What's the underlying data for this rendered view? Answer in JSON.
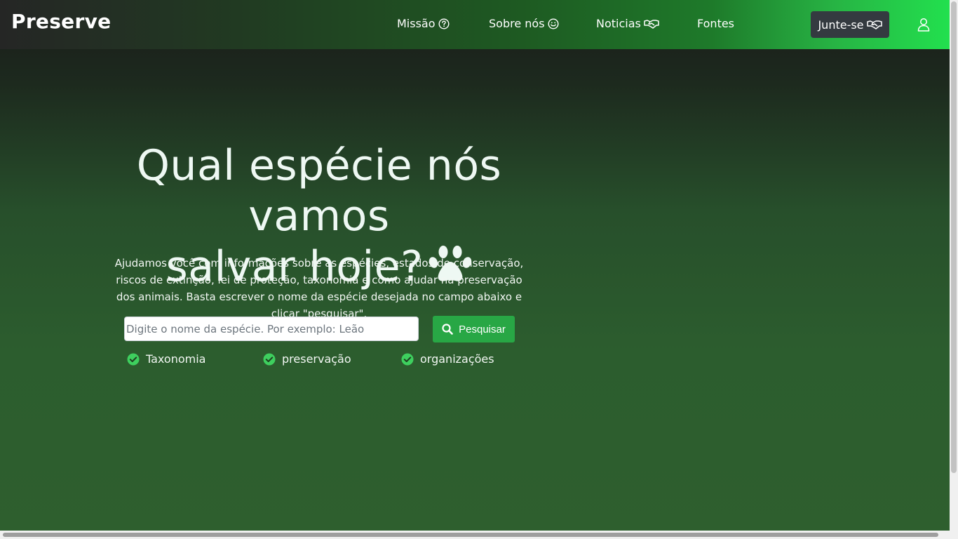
{
  "navbar": {
    "brand": "Preserve",
    "links": [
      {
        "label": "Missão",
        "icon": "question-circle-icon"
      },
      {
        "label": "Sobre nós",
        "icon": "smile-icon"
      },
      {
        "label": "Noticias",
        "icon": "handshake-icon"
      },
      {
        "label": "Fontes",
        "icon": ""
      }
    ],
    "join_label": "Junte-se",
    "join_icon": "handshake-icon",
    "user_icon": "user-icon"
  },
  "hero": {
    "title_line1": "Qual espécie nós vamos",
    "title_line2": "salvar hoje?",
    "title_icon": "paw-icon",
    "description": "Ajudamos você com informações sobre as espécies, estados de conservação, riscos de extinção, lei de proteção, taxonomia e como ajudar na preservação dos animais. Basta escrever o nome da espécie desejada no campo abaixo e clicar \"pesquisar\".",
    "search_placeholder": "Digite o nome da espécie. Por exemplo: Leão",
    "search_value": "",
    "search_button": "Pesquisar",
    "features": [
      "Taxonomia",
      "preservação",
      "organizações"
    ]
  },
  "colors": {
    "accent": "#28a745",
    "dark_button": "#343a40",
    "check": "#3ecf5e"
  }
}
